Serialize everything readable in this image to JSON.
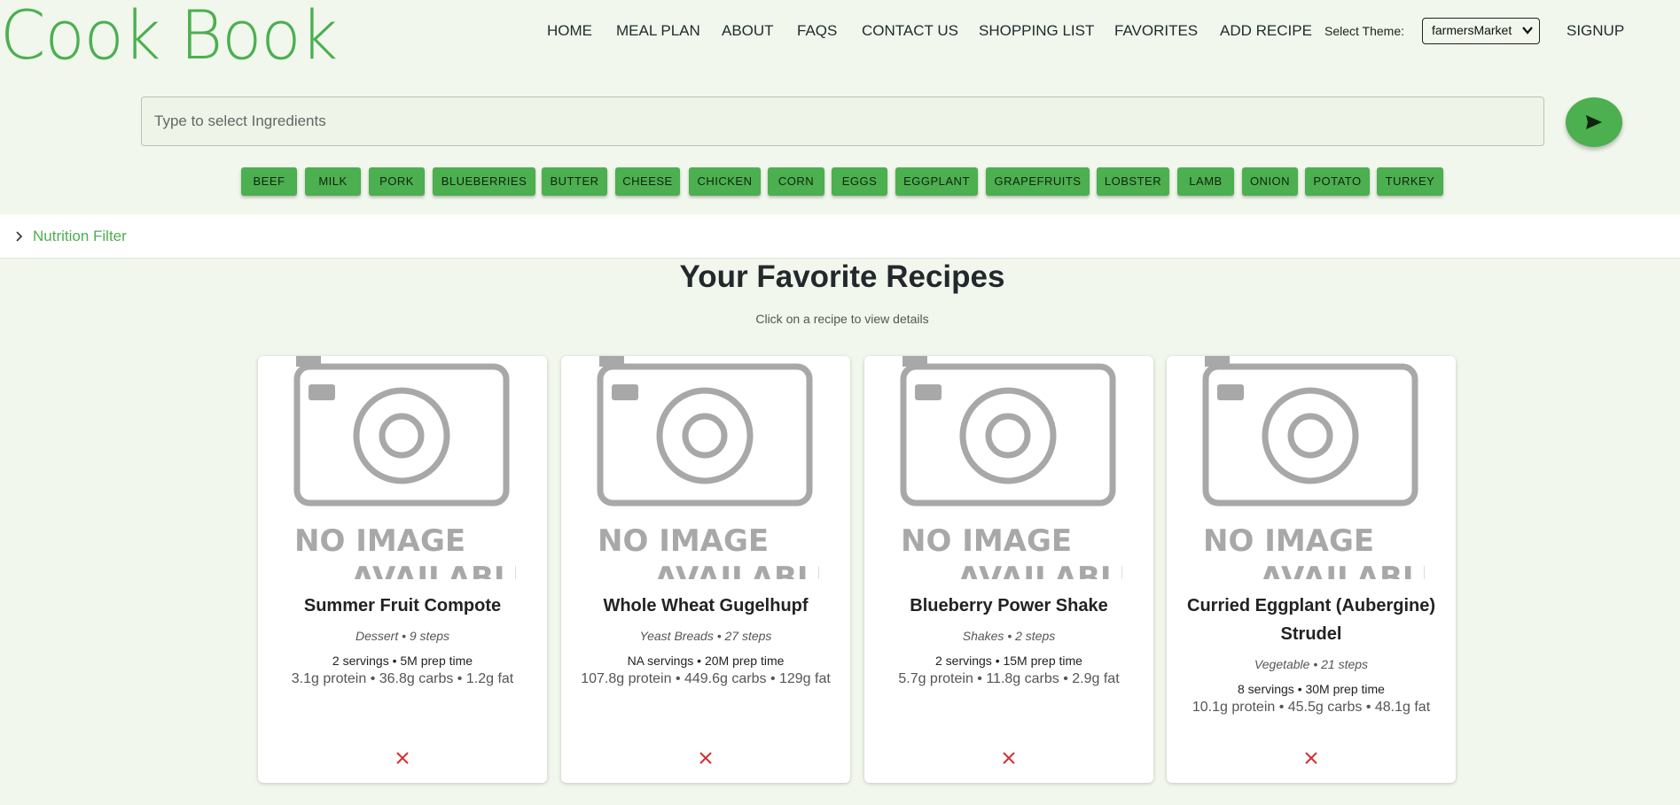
{
  "app": {
    "logo": "Cook Book"
  },
  "nav": {
    "items": [
      "HOME",
      "MEAL PLAN",
      "ABOUT",
      "FAQS",
      "CONTACT US",
      "SHOPPING LIST",
      "FAVORITES",
      "ADD RECIPE"
    ],
    "theme_label": "Select Theme:",
    "theme_value": "farmersMarket",
    "signup": "SIGNUP"
  },
  "search": {
    "placeholder": "Type to select Ingredients",
    "send_icon": "send-icon"
  },
  "ingredients": [
    "BEEF",
    "MILK",
    "PORK",
    "BLUEBERRIES",
    "BUTTER",
    "CHEESE",
    "CHICKEN",
    "CORN",
    "EGGS",
    "EGGPLANT",
    "GRAPEFRUITS",
    "LOBSTER",
    "LAMB",
    "ONION",
    "POTATO",
    "TURKEY"
  ],
  "nutrition_filter": {
    "label": "Nutrition Filter",
    "icon": "chevron-right-icon"
  },
  "favorites": {
    "title": "Your Favorite Recipes",
    "subtitle": "Click on a recipe to view details",
    "image_placeholder": "NO IMAGE AVAILABLE",
    "recipes": [
      {
        "title": "Summer Fruit Compote",
        "meta": "Dessert • 9 steps",
        "servings": "2 servings • 5M prep time",
        "macros": "3.1g protein • 36.8g carbs • 1.2g fat"
      },
      {
        "title": "Whole Wheat Gugelhupf",
        "meta": "Yeast Breads • 27 steps",
        "servings": "NA servings • 20M prep time",
        "macros": "107.8g protein • 449.6g carbs • 129g fat"
      },
      {
        "title": "Blueberry Power Shake",
        "meta": "Shakes • 2 steps",
        "servings": "2 servings • 15M prep time",
        "macros": "5.7g protein • 11.8g carbs • 2.9g fat"
      },
      {
        "title": "Curried Eggplant (Aubergine) Strudel",
        "meta": "Vegetable • 21 steps",
        "servings": "8 servings • 30M prep time",
        "macros": "10.1g protein • 45.5g carbs • 48.1g fat"
      }
    ]
  },
  "colors": {
    "accent": "#4caf50",
    "background": "#f1f7ec",
    "remove": "#d32f2f"
  }
}
